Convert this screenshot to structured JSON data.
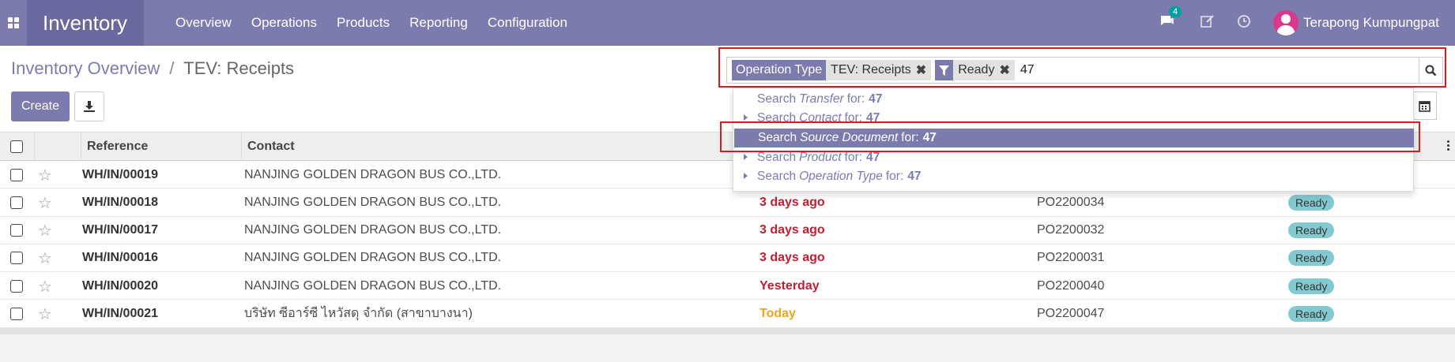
{
  "nav": {
    "brand": "Inventory",
    "menu": [
      "Overview",
      "Operations",
      "Products",
      "Reporting",
      "Configuration"
    ],
    "chat_count": "4",
    "user_name": "Terapong Kumpungpat",
    "accent_color": "#7c7bad"
  },
  "control": {
    "breadcrumb_link": "Inventory Overview",
    "breadcrumb_sep": "/",
    "breadcrumb_current": "TEV: Receipts",
    "create_label": "Create"
  },
  "search": {
    "facets": [
      {
        "category": "Operation Type",
        "value": "TEV: Receipts"
      },
      {
        "category": "filter-icon",
        "value": "Ready"
      }
    ],
    "query": "47",
    "suggestions": [
      {
        "prefix": "Search",
        "field": "Transfer",
        "suffix": "for:",
        "value": "47",
        "expandable": false
      },
      {
        "prefix": "Search",
        "field": "Contact",
        "suffix": "for:",
        "value": "47",
        "expandable": true
      },
      {
        "prefix": "Search",
        "field": "Source Document",
        "suffix": "for:",
        "value": "47",
        "expandable": false,
        "active": true
      },
      {
        "prefix": "Search",
        "field": "Product",
        "suffix": "for:",
        "value": "47",
        "expandable": true
      },
      {
        "prefix": "Search",
        "field": "Operation Type",
        "suffix": "for:",
        "value": "47",
        "expandable": true
      }
    ]
  },
  "table": {
    "headers": {
      "reference": "Reference",
      "contact": "Contact"
    },
    "rows": [
      {
        "reference": "WH/IN/00019",
        "contact": "NANJING GOLDEN DRAGON BUS CO.,LTD.",
        "date": "",
        "source": "",
        "status": ""
      },
      {
        "reference": "WH/IN/00018",
        "contact": "NANJING GOLDEN DRAGON BUS CO.,LTD.",
        "date": "3 days ago",
        "source": "PO2200034",
        "status": "Ready"
      },
      {
        "reference": "WH/IN/00017",
        "contact": "NANJING GOLDEN DRAGON BUS CO.,LTD.",
        "date": "3 days ago",
        "source": "PO2200032",
        "status": "Ready"
      },
      {
        "reference": "WH/IN/00016",
        "contact": "NANJING GOLDEN DRAGON BUS CO.,LTD.",
        "date": "3 days ago",
        "source": "PO2200031",
        "status": "Ready"
      },
      {
        "reference": "WH/IN/00020",
        "contact": "NANJING GOLDEN DRAGON BUS CO.,LTD.",
        "date": "Yesterday",
        "source": "PO2200040",
        "status": "Ready"
      },
      {
        "reference": "WH/IN/00021",
        "contact": "บริษัท ซีอาร์ซี ไหวัสดุ จำกัด (สาขาบางนา)",
        "date": "Today",
        "source": "PO2200047",
        "status": "Ready"
      }
    ]
  }
}
